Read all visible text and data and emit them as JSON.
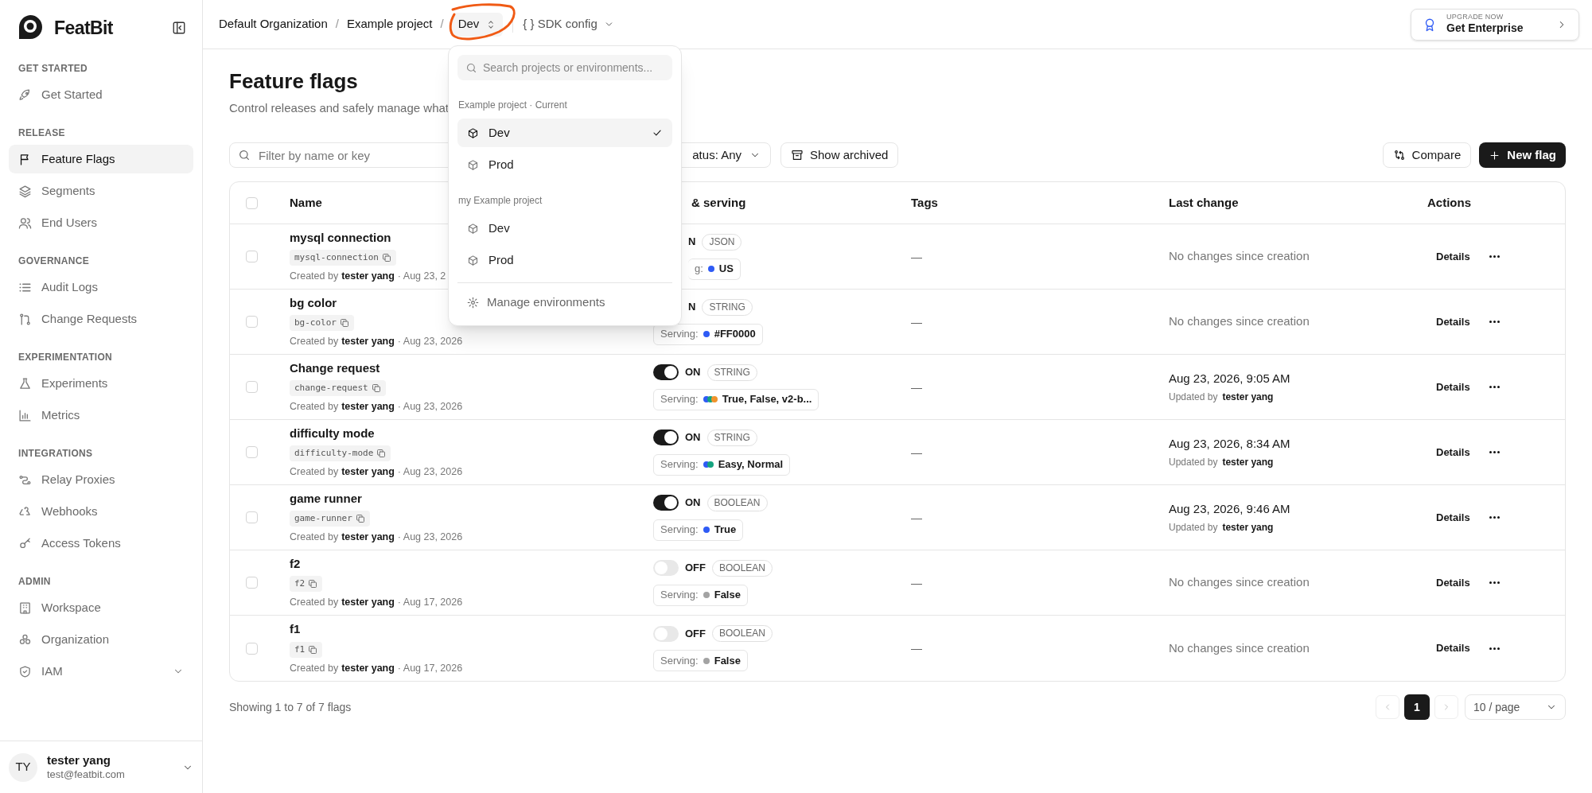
{
  "sidebar": {
    "brand": "FeatBit",
    "sections": [
      {
        "title": "GET STARTED",
        "items": [
          {
            "label": "Get Started",
            "selected": false,
            "kind": "link"
          }
        ]
      },
      {
        "title": "RELEASE",
        "items": [
          {
            "label": "Feature Flags",
            "selected": true,
            "kind": "link"
          },
          {
            "label": "Segments",
            "selected": false,
            "kind": "link"
          },
          {
            "label": "End Users",
            "selected": false,
            "kind": "link"
          }
        ]
      },
      {
        "title": "GOVERNANCE",
        "items": [
          {
            "label": "Audit Logs",
            "selected": false,
            "kind": "link"
          },
          {
            "label": "Change Requests",
            "selected": false,
            "kind": "link"
          }
        ]
      },
      {
        "title": "EXPERIMENTATION",
        "items": [
          {
            "label": "Experiments",
            "selected": false,
            "kind": "link"
          },
          {
            "label": "Metrics",
            "selected": false,
            "kind": "link"
          }
        ]
      },
      {
        "title": "INTEGRATIONS",
        "items": [
          {
            "label": "Relay Proxies",
            "selected": false,
            "kind": "link"
          },
          {
            "label": "Webhooks",
            "selected": false,
            "kind": "link"
          },
          {
            "label": "Access Tokens",
            "selected": false,
            "kind": "link"
          }
        ]
      },
      {
        "title": "ADMIN",
        "items": [
          {
            "label": "Workspace",
            "selected": false,
            "kind": "link"
          },
          {
            "label": "Organization",
            "selected": false,
            "kind": "link"
          },
          {
            "label": "IAM",
            "selected": false,
            "kind": "group"
          }
        ]
      }
    ],
    "user": {
      "initials": "TY",
      "name": "tester yang",
      "email": "test@featbit.com"
    }
  },
  "topbar": {
    "breadcrumbs": [
      {
        "label": "Default Organization",
        "separator": "/"
      },
      {
        "label": "Example project",
        "separator": "/"
      }
    ],
    "environment": "Dev",
    "sdk_config": "{ } SDK config",
    "upgrade": {
      "eyebrow": "UPGRADE NOW",
      "label": "Get Enterprise"
    }
  },
  "env_dropdown": {
    "placeholder": "Search projects or environments...",
    "groups": [
      {
        "title": "Example project · Current",
        "items": [
          {
            "label": "Dev",
            "selected": true
          },
          {
            "label": "Prod",
            "selected": false
          }
        ]
      },
      {
        "title": "my Example project",
        "items": [
          {
            "label": "Dev",
            "selected": false
          },
          {
            "label": "Prod",
            "selected": false
          }
        ]
      }
    ],
    "footer": "Manage environments"
  },
  "page": {
    "title": "Feature flags",
    "subtitle": "Control releases and safely manage what"
  },
  "toolbar": {
    "filter_placeholder": "Filter by name or key",
    "status_filter": "atus: Any",
    "show_archived": "Show archived",
    "compare": "Compare",
    "new_flag": "New flag"
  },
  "table": {
    "select_all": {
      "checked": false
    },
    "columns": [
      "Name",
      "& serving",
      "Tags",
      "Last change",
      "Actions"
    ],
    "rows": [
      {
        "checked": false,
        "name": "mysql connection",
        "key": "mysql-connection",
        "created": {
          "label": "Created by",
          "user": "tester yang",
          "date": "· Aug 23, 2"
        },
        "targeting": {
          "kind": "partial",
          "status": "N",
          "type": "JSON",
          "serving_label": "g:",
          "serving": "US",
          "dots": [
            {
              "color": "#2f5bf5"
            }
          ]
        },
        "tags": "—",
        "last_change": {
          "kind": "none",
          "text": "No changes since creation"
        },
        "details": "Details"
      },
      {
        "checked": false,
        "name": "bg color",
        "key": "bg-color",
        "created": {
          "label": "Created by",
          "user": "tester yang",
          "date": "· Aug 23, 2026"
        },
        "targeting": {
          "kind": "full",
          "status": "N",
          "type": "STRING",
          "serving_label": "Serving:",
          "serving": "#FF0000",
          "dots": [
            {
              "color": "#2f5bf5"
            }
          ]
        },
        "tags": "—",
        "last_change": {
          "kind": "none",
          "text": "No changes since creation"
        },
        "details": "Details"
      },
      {
        "checked": false,
        "name": "Change request",
        "key": "change-request",
        "created": {
          "label": "Created by",
          "user": "tester yang",
          "date": "· Aug 23, 2026"
        },
        "targeting": {
          "kind": "full",
          "toggle": {
            "on": true
          },
          "status": "ON",
          "type": "STRING",
          "serving_label": "Serving:",
          "serving": "True, False, v2-b...",
          "dots": [
            {
              "color": "#2f5bf5"
            },
            {
              "color": "#14a37f"
            },
            {
              "color": "#f0932b"
            }
          ]
        },
        "tags": "—",
        "last_change": {
          "kind": "updated",
          "date": "Aug 23, 2026, 9:05 AM",
          "label": "Updated by",
          "user": "tester yang"
        },
        "details": "Details"
      },
      {
        "checked": false,
        "name": "difficulty mode",
        "key": "difficulty-mode",
        "created": {
          "label": "Created by",
          "user": "tester yang",
          "date": "· Aug 23, 2026"
        },
        "targeting": {
          "kind": "full",
          "toggle": {
            "on": true
          },
          "status": "ON",
          "type": "STRING",
          "serving_label": "Serving:",
          "serving": "Easy, Normal",
          "dots": [
            {
              "color": "#2f5bf5"
            },
            {
              "color": "#14a37f"
            }
          ]
        },
        "tags": "—",
        "last_change": {
          "kind": "updated",
          "date": "Aug 23, 2026, 8:34 AM",
          "label": "Updated by",
          "user": "tester yang"
        },
        "details": "Details"
      },
      {
        "checked": false,
        "name": "game runner",
        "key": "game-runner",
        "created": {
          "label": "Created by",
          "user": "tester yang",
          "date": "· Aug 23, 2026"
        },
        "targeting": {
          "kind": "full",
          "toggle": {
            "on": true
          },
          "status": "ON",
          "type": "BOOLEAN",
          "serving_label": "Serving:",
          "serving": "True",
          "dots": [
            {
              "color": "#2f5bf5"
            }
          ]
        },
        "tags": "—",
        "last_change": {
          "kind": "updated",
          "date": "Aug 23, 2026, 9:46 AM",
          "label": "Updated by",
          "user": "tester yang"
        },
        "details": "Details"
      },
      {
        "checked": false,
        "name": "f2",
        "key": "f2",
        "created": {
          "label": "Created by",
          "user": "tester yang",
          "date": "· Aug 17, 2026"
        },
        "targeting": {
          "kind": "full",
          "toggle": {
            "on": false
          },
          "status": "OFF",
          "type": "BOOLEAN",
          "serving_label": "Serving:",
          "serving": "False",
          "dots": [
            {
              "color": "#a3a3a3"
            }
          ]
        },
        "tags": "—",
        "last_change": {
          "kind": "none",
          "text": "No changes since creation"
        },
        "details": "Details"
      },
      {
        "checked": false,
        "name": "f1",
        "key": "f1",
        "created": {
          "label": "Created by",
          "user": "tester yang",
          "date": "· Aug 17, 2026"
        },
        "targeting": {
          "kind": "full",
          "toggle": {
            "on": false
          },
          "status": "OFF",
          "type": "BOOLEAN",
          "serving_label": "Serving:",
          "serving": "False",
          "dots": [
            {
              "color": "#a3a3a3"
            }
          ]
        },
        "tags": "—",
        "last_change": {
          "kind": "none",
          "text": "No changes since creation"
        },
        "details": "Details"
      }
    ]
  },
  "footer": {
    "summary": "Showing 1 to 7 of 7 flags",
    "pages": [
      {
        "label": "1",
        "selected": true
      }
    ],
    "page_size": "10 / page"
  }
}
